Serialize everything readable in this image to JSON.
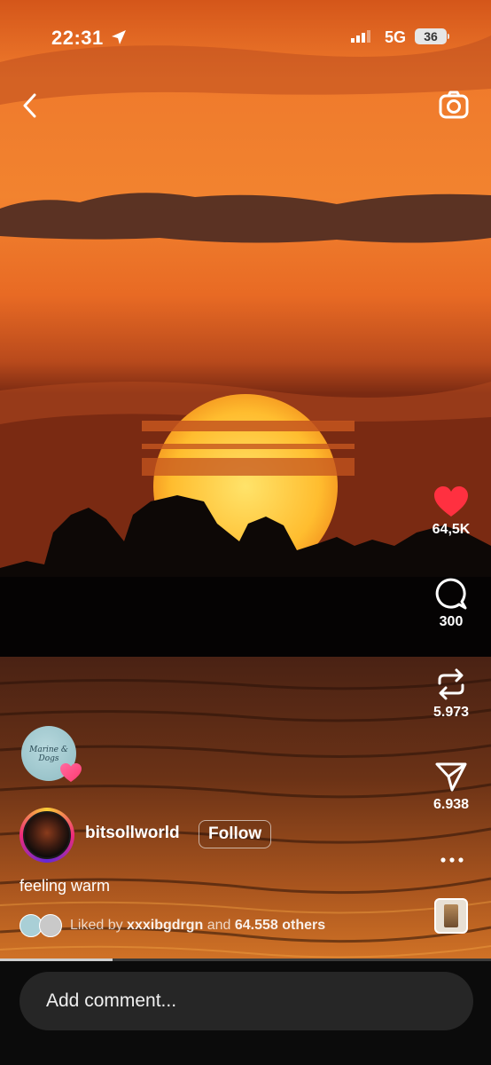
{
  "status_bar": {
    "time": "22:31",
    "network": "5G",
    "battery": "36"
  },
  "post": {
    "author": "bitsollworld",
    "follow_label": "Follow",
    "caption": "feeling warm",
    "liked_by_prefix": "Liked by ",
    "liked_by_user": "xxxibgdrgn",
    "liked_by_middle": " and ",
    "liked_by_others": "64.558 others",
    "audio_avatar_text": "Marine & Dogs"
  },
  "actions": {
    "likes": "64,5K",
    "comments": "300",
    "reposts": "5.973",
    "shares": "6.938"
  },
  "comment_box": {
    "placeholder": "Add comment..."
  },
  "playback": {
    "progress": 0.23
  },
  "colors": {
    "heart": "#ff3040",
    "sky": "#f07a2a",
    "sun": "#ffc53a",
    "input_bg": "#262626"
  }
}
